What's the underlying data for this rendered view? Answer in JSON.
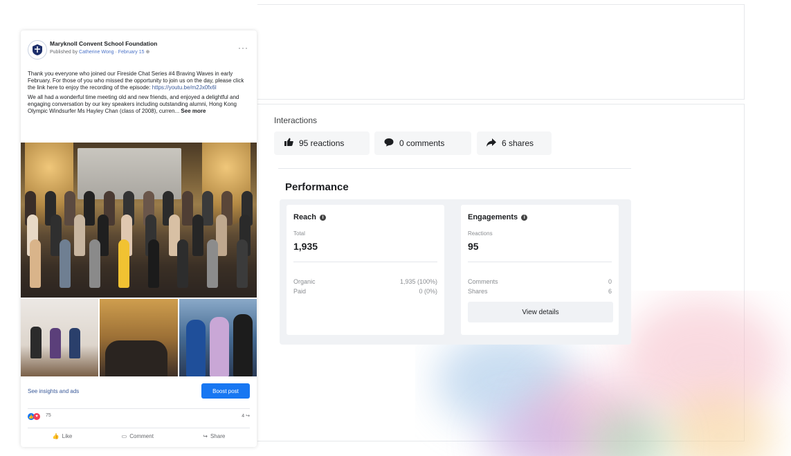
{
  "post": {
    "page_name": "Maryknoll Convent School Foundation",
    "published_by_prefix": "Published by",
    "author": "Catherine Wong",
    "date": "February 15",
    "paragraph1": "Thank you everyone who joined our Fireside Chat Series #4 Braving Waves in early February. For those of you who missed the opportunity to join us on the day, please click the link here to enjoy the recording of the episode:",
    "link": "https://youtu.be/m2Jx0fx6l",
    "paragraph2": "We all had a wonderful time meeting old and new friends, and enjoyed a delightful and engaging conversation by our key speakers including outstanding alumni, Hong Kong Olympic Windsurfer Ms Hayley Chan (class of 2008), curren...",
    "see_more": "See more",
    "insights_link": "See insights and ads",
    "boost_label": "Boost post",
    "reaction_count": "75",
    "share_count": "4",
    "actions": [
      "Like",
      "Comment",
      "Share"
    ]
  },
  "interactions": {
    "title": "Interactions",
    "reactions": "95 reactions",
    "comments": "0 comments",
    "shares": "6 shares"
  },
  "performance": {
    "title": "Performance",
    "reach": {
      "title": "Reach",
      "sublabel": "Total",
      "value": "1,935",
      "rows": [
        {
          "label": "Organic",
          "value": "1,935 (100%)"
        },
        {
          "label": "Paid",
          "value": "0 (0%)"
        }
      ]
    },
    "engagements": {
      "title": "Engagements",
      "sublabel": "Reactions",
      "value": "95",
      "rows": [
        {
          "label": "Comments",
          "value": "0"
        },
        {
          "label": "Shares",
          "value": "6"
        }
      ],
      "button": "View details"
    }
  },
  "colors": {
    "accent": "#1877f2",
    "link": "#385898",
    "panel": "#f0f2f5"
  }
}
